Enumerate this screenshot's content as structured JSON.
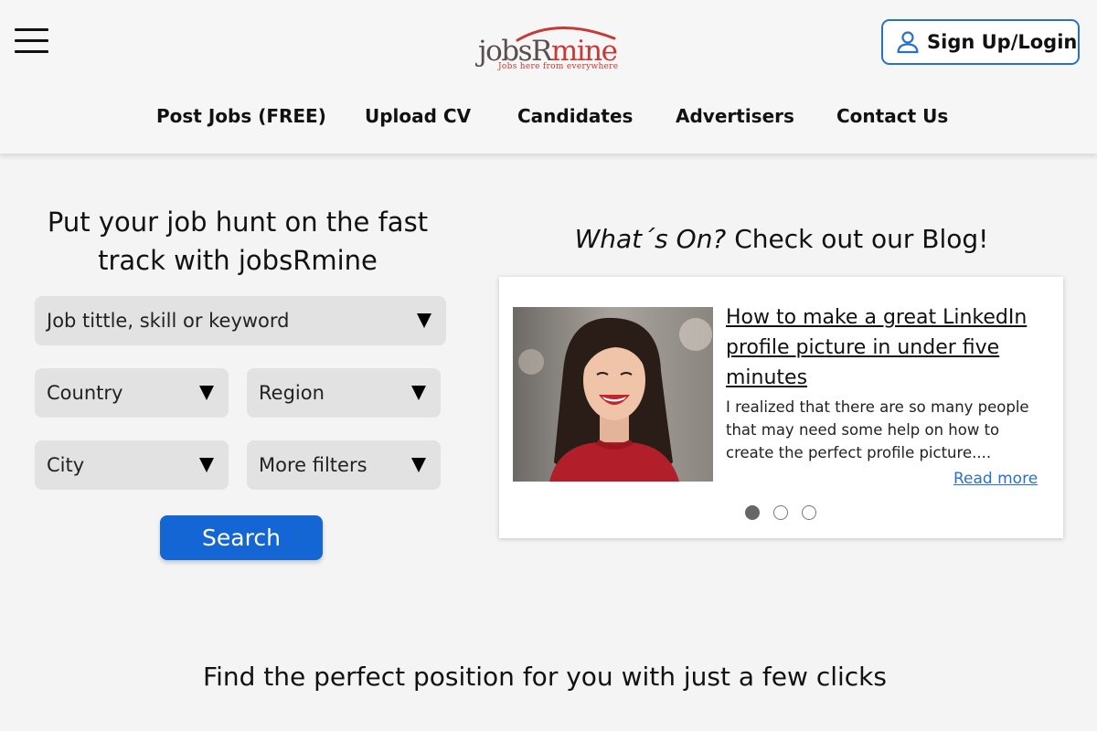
{
  "header": {
    "logo": {
      "name_part1": "jobsR",
      "name_part2": "mine",
      "tagline": "Jobs here from everywhere"
    },
    "signup_label": "Sign Up/Login",
    "nav": [
      "Post Jobs (FREE)",
      "Upload CV",
      "Candidates",
      "Advertisers",
      "Contact Us"
    ]
  },
  "search": {
    "title": "Put your job hunt on the fast track with jobsRmine",
    "keyword_placeholder": "Job tittle, skill or keyword",
    "country": "Country",
    "region": "Region",
    "city": "City",
    "more_filters": "More filters",
    "button": "Search"
  },
  "blog": {
    "title_italic": "What´s On?",
    "title_rest": " Check out our Blog!",
    "headline": "How to make a great LinkedIn profile picture in under five minutes",
    "excerpt": "I realized that there are so many people that may need some help on how to create the perfect profile picture....",
    "read_more": "Read more",
    "carousel_pages": 3,
    "active_page": 1
  },
  "bottom": {
    "title": "Find the perfect position for you with just a few clicks"
  },
  "colors": {
    "accent": "#1466d4",
    "link": "#2871c9",
    "logo_red": "#c63a36"
  }
}
